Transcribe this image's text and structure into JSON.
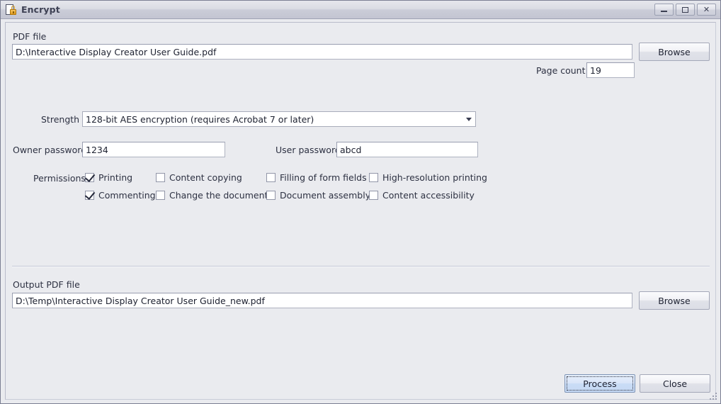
{
  "window": {
    "title": "Encrypt",
    "icon": "document-lock-icon",
    "caption_buttons": [
      {
        "name": "minimize",
        "glyph": "—"
      },
      {
        "name": "maximize",
        "glyph": "□"
      },
      {
        "name": "close",
        "glyph": "✕"
      }
    ]
  },
  "pdf_file": {
    "label": "PDF file",
    "value": "D:\\Interactive Display Creator User Guide.pdf",
    "placeholder": "",
    "browse_label": "Browse"
  },
  "page_count": {
    "label": "Page count",
    "value": "19"
  },
  "strength": {
    "label": "Strength",
    "value": "128-bit AES encryption (requires Acrobat 7 or later)",
    "options": [
      "128-bit AES encryption (requires Acrobat 7 or later)"
    ]
  },
  "owner_password": {
    "label": "Owner password",
    "value": "1234",
    "placeholder": ""
  },
  "user_password": {
    "label": "User password",
    "value": "abcd",
    "placeholder": ""
  },
  "permissions": {
    "label": "Permissions:",
    "items": [
      {
        "label": "Printing",
        "checked": true
      },
      {
        "label": "Commenting",
        "checked": true
      },
      {
        "label": "Content copying",
        "checked": false
      },
      {
        "label": "Change the document",
        "checked": false
      },
      {
        "label": "Filling of form fields",
        "checked": false
      },
      {
        "label": "Document assembly",
        "checked": false
      },
      {
        "label": "High-resolution printing",
        "checked": false
      },
      {
        "label": "Content accessibility",
        "checked": false
      }
    ]
  },
  "output_file": {
    "label": "Output PDF file",
    "value": "D:\\Temp\\Interactive Display Creator User Guide_new.pdf",
    "placeholder": "",
    "browse_label": "Browse"
  },
  "actions": {
    "process_label": "Process",
    "close_label": "Close"
  },
  "colors": {
    "window_bg": "#eaebef",
    "titlebar_top": "#e6e7ec",
    "titlebar_bottom": "#c3c5d2",
    "border": "#7b7f93",
    "text": "#2d3142",
    "field_bg": "#ffffff",
    "focus_button_bg": "#c9dcf6",
    "lock_gold": "#e09a1e"
  }
}
